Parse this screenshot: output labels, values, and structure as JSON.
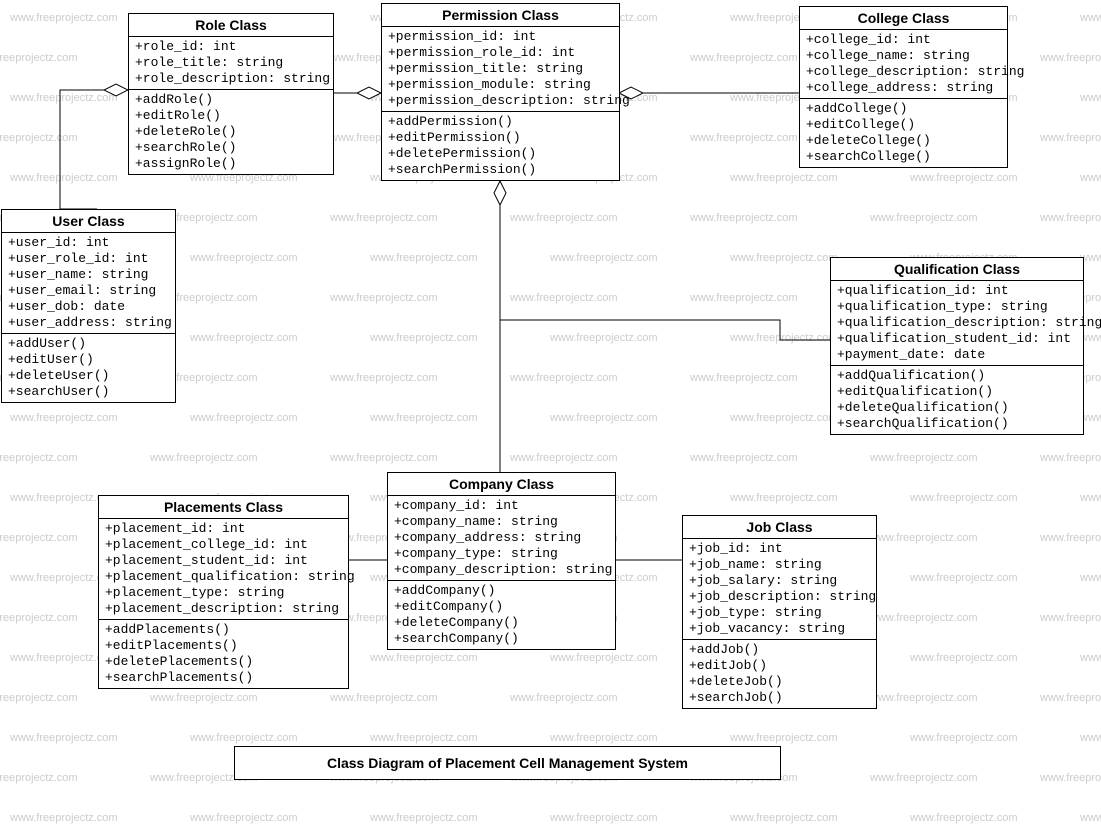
{
  "watermark": "www.freeprojectz.com",
  "title": "Class Diagram of Placement Cell Management System",
  "classes": {
    "role": {
      "name": "Role Class",
      "attrs": [
        "+role_id: int",
        "+role_title: string",
        "+role_description: string"
      ],
      "ops": [
        "+addRole()",
        "+editRole()",
        "+deleteRole()",
        "+searchRole()",
        "+assignRole()"
      ]
    },
    "permission": {
      "name": "Permission Class",
      "attrs": [
        "+permission_id: int",
        "+permission_role_id: int",
        "+permission_title: string",
        "+permission_module: string",
        "+permission_description: string"
      ],
      "ops": [
        "+addPermission()",
        "+editPermission()",
        "+deletePermission()",
        "+searchPermission()"
      ]
    },
    "college": {
      "name": "College Class",
      "attrs": [
        "+college_id: int",
        "+college_name: string",
        "+college_description: string",
        "+college_address: string"
      ],
      "ops": [
        "+addCollege()",
        "+editCollege()",
        "+deleteCollege()",
        "+searchCollege()"
      ]
    },
    "user": {
      "name": "User Class",
      "attrs": [
        "+user_id: int",
        "+user_role_id: int",
        "+user_name: string",
        "+user_email: string",
        "+user_dob: date",
        "+user_address: string"
      ],
      "ops": [
        "+addUser()",
        "+editUser()",
        "+deleteUser()",
        "+searchUser()"
      ]
    },
    "qualification": {
      "name": "Qualification Class",
      "attrs": [
        "+qualification_id: int",
        "+qualification_type: string",
        "+qualification_description: string",
        "+qualification_student_id: int",
        "+payment_date: date"
      ],
      "ops": [
        "+addQualification()",
        "+editQualification()",
        "+deleteQualification()",
        "+searchQualification()"
      ]
    },
    "company": {
      "name": "Company  Class",
      "attrs": [
        "+company_id: int",
        "+company_name: string",
        "+company_address: string",
        "+company_type: string",
        "+company_description: string"
      ],
      "ops": [
        "+addCompany()",
        "+editCompany()",
        "+deleteCompany()",
        "+searchCompany()"
      ]
    },
    "placements": {
      "name": "Placements Class",
      "attrs": [
        "+placement_id: int",
        "+placement_college_id: int",
        "+placement_student_id: int",
        "+placement_qualification: string",
        "+placement_type: string",
        "+placement_description: string"
      ],
      "ops": [
        "+addPlacements()",
        "+editPlacements()",
        "+deletePlacements()",
        "+searchPlacements()"
      ]
    },
    "job": {
      "name": "Job Class",
      "attrs": [
        "+job_id: int",
        "+job_name: string",
        "+job_salary: string",
        "+job_description: string",
        "+job_type: string",
        "+job_vacancy: string"
      ],
      "ops": [
        "+addJob()",
        "+editJob()",
        "+deleteJob()",
        "+searchJob()"
      ]
    }
  }
}
